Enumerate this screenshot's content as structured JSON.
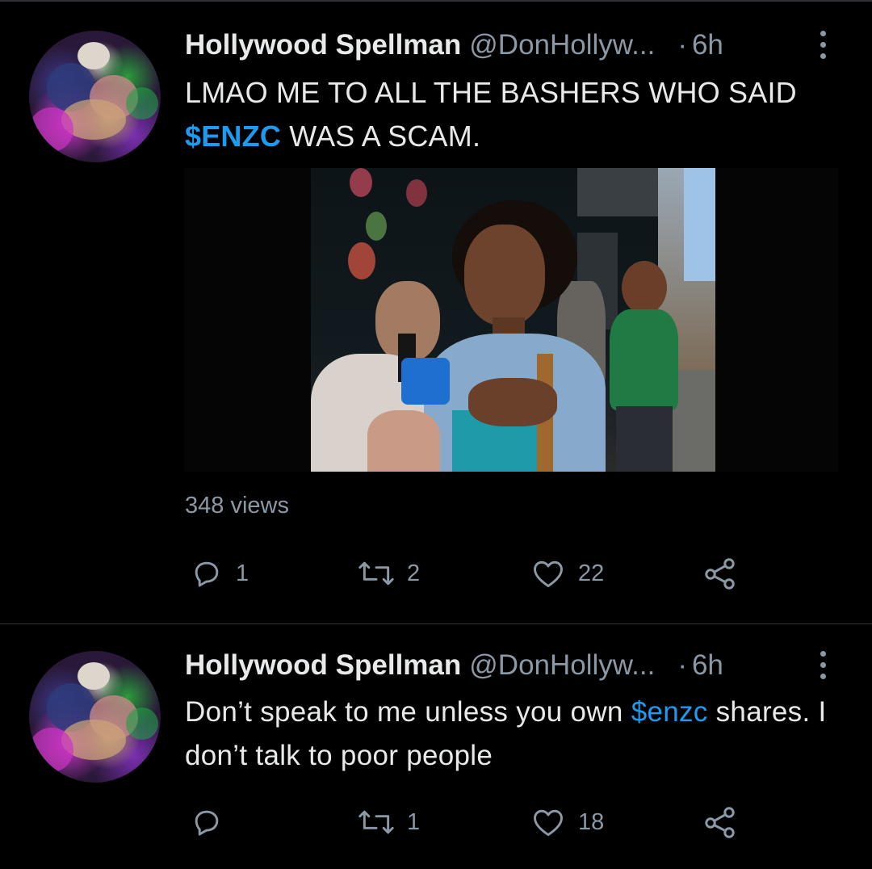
{
  "tweets": [
    {
      "display_name": "Hollywood Spellman",
      "handle": "@DonHollyw...",
      "separator": "·",
      "time": "6h",
      "text_before": "LMAO ME TO ALL THE BASHERS WHO SAID",
      "cashtag": "$ENZC",
      "text_after": " WAS A SCAM.",
      "views": "348 views",
      "reply_count": "1",
      "retweet_count": "2",
      "like_count": "22"
    },
    {
      "display_name": "Hollywood Spellman",
      "handle": "@DonHollyw...",
      "separator": "·",
      "time": "6h",
      "text_before": "Don’t speak to me unless you own ",
      "cashtag": "$enzc",
      "text_after": " shares. I don’t talk to poor people",
      "reply_count": "",
      "retweet_count": "1",
      "like_count": "18"
    }
  ],
  "icons": {
    "reply": "reply-icon",
    "retweet": "retweet-icon",
    "like": "heart-icon",
    "share": "share-icon",
    "more": "more-options-icon"
  },
  "colors": {
    "background": "#000000",
    "text": "#e7e9ea",
    "secondary": "#8b98a5",
    "accent": "#1d9bf0",
    "divider": "#2f3336"
  }
}
